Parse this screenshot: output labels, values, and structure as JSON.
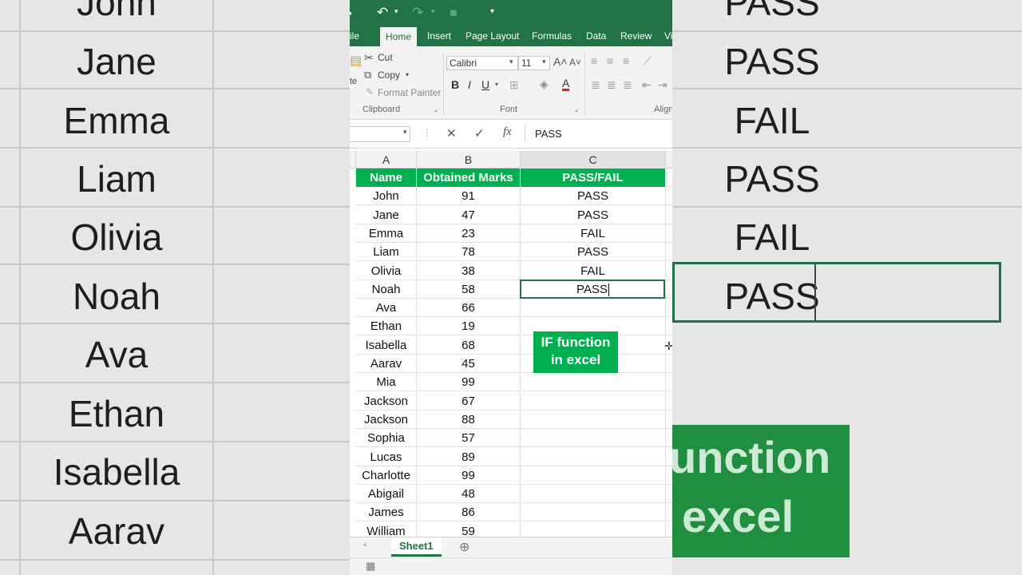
{
  "ribbon": {
    "tabs": [
      "ile",
      "Home",
      "Insert",
      "Page Layout",
      "Formulas",
      "Data",
      "Review",
      "Vi"
    ],
    "active_tab": "Home",
    "clipboard": {
      "cut": "Cut",
      "copy": "Copy",
      "format_painter": "Format Painter",
      "group_label": "Clipboard",
      "paste_fragment": "te"
    },
    "font": {
      "name": "Calibri",
      "size": "11",
      "group_label": "Font"
    },
    "alignment": {
      "group_label": "Align"
    }
  },
  "formula_bar": {
    "name_box": "",
    "content": "PASS"
  },
  "columns": [
    "A",
    "B",
    "C"
  ],
  "table": {
    "headers": [
      "Name",
      "Obtained Marks",
      "PASS/FAIL"
    ],
    "rows": [
      [
        "John",
        "91",
        "PASS"
      ],
      [
        "Jane",
        "47",
        "PASS"
      ],
      [
        "Emma",
        "23",
        "FAIL"
      ],
      [
        "Liam",
        "78",
        "PASS"
      ],
      [
        "Olivia",
        "38",
        "FAIL"
      ],
      [
        "Noah",
        "58",
        "PASS"
      ],
      [
        "Ava",
        "66",
        ""
      ],
      [
        "Ethan",
        "19",
        ""
      ],
      [
        "Isabella",
        "68",
        ""
      ],
      [
        "Aarav",
        "45",
        ""
      ],
      [
        "Mia",
        "99",
        ""
      ],
      [
        "Jackson",
        "67",
        ""
      ],
      [
        "Jackson",
        "88",
        ""
      ],
      [
        "Sophia",
        "57",
        ""
      ],
      [
        "Lucas",
        "89",
        ""
      ],
      [
        "Charlotte",
        "99",
        ""
      ],
      [
        "Abigail",
        "48",
        ""
      ],
      [
        "James",
        "86",
        ""
      ],
      [
        "William",
        "59",
        ""
      ]
    ]
  },
  "badge": {
    "line1": "IF function",
    "line2": "in excel"
  },
  "sheet_tab": "Sheet1",
  "background": {
    "left_names": [
      "John",
      "Jane",
      "Emma",
      "Liam",
      "Olivia",
      "Noah",
      "Ava",
      "Ethan",
      "Isabella",
      "Aarav"
    ],
    "right_results": [
      "PASS",
      "PASS",
      "FAIL",
      "PASS",
      "FAIL",
      "PASS"
    ],
    "banner_line1": "unction",
    "banner_line2": "excel"
  },
  "colors": {
    "excel_green": "#217346",
    "header_green": "#00b050"
  }
}
